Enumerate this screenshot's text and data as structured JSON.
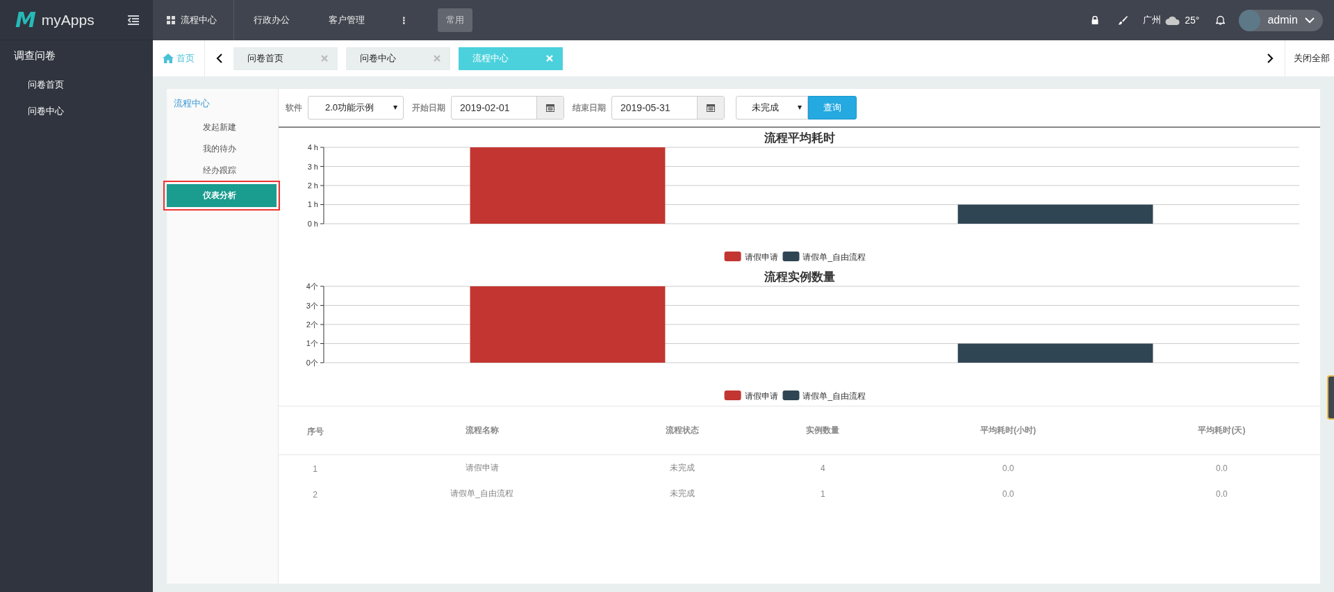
{
  "sidebar": {
    "logo_letter": "M",
    "logo_text": "myApps",
    "section": "调查问卷",
    "items": [
      {
        "label": "问卷首页",
        "selected": false
      },
      {
        "label": "问卷中心",
        "selected": false
      }
    ]
  },
  "top_nav": {
    "items": [
      {
        "label": "流程中心",
        "kind": "apps"
      },
      {
        "label": "行政办公",
        "kind": "plain"
      },
      {
        "label": "客户管理",
        "kind": "plain"
      },
      {
        "label": "⋮",
        "kind": "more"
      }
    ],
    "chip": "常用",
    "city": "广州",
    "temperature": "25°",
    "user": "admin"
  },
  "tab_bar": {
    "home": "首页",
    "tabs": [
      {
        "label": "问卷首页",
        "selected": false
      },
      {
        "label": "问卷中心",
        "selected": false
      },
      {
        "label": "流程中心",
        "selected": true
      }
    ],
    "close_all": "关闭全部"
  },
  "side_menu": {
    "title": "流程中心",
    "items": [
      {
        "label": "发起新建",
        "selected": false
      },
      {
        "label": "我的待办",
        "selected": false
      },
      {
        "label": "经办跟踪",
        "selected": false
      },
      {
        "label": "仪表分析",
        "selected": true
      }
    ]
  },
  "filters": {
    "software_label": "软件",
    "software": "2.0功能示例",
    "start_label": "开始日期",
    "start": "2019-02-01",
    "end_label": "结束日期",
    "end": "2019-05-31",
    "status": "未完成",
    "query": "查询"
  },
  "charts": [
    {
      "chart_data": {
        "type": "bar",
        "title": "流程平均耗时",
        "grid": true,
        "legend": true,
        "ylim": [
          0,
          4
        ],
        "yticks": [
          {
            "value": 0,
            "label": "0 h"
          },
          {
            "value": 1,
            "label": "1 h"
          },
          {
            "value": 2,
            "label": "2 h"
          },
          {
            "value": 3,
            "label": "3 h"
          },
          {
            "value": 4,
            "label": "4 h"
          }
        ],
        "series": [
          {
            "name": "请假申请",
            "color": "#c23531",
            "values": [
              4,
              null
            ]
          },
          {
            "name": "请假单_自由流程",
            "color": "#2f4554",
            "values": [
              null,
              1
            ]
          }
        ]
      }
    },
    {
      "chart_data": {
        "type": "bar",
        "title": "流程实例数量",
        "grid": true,
        "legend": true,
        "ylim": [
          0,
          4
        ],
        "yticks": [
          {
            "value": 0,
            "label": "0个"
          },
          {
            "value": 1,
            "label": "1个"
          },
          {
            "value": 2,
            "label": "2个"
          },
          {
            "value": 3,
            "label": "3个"
          },
          {
            "value": 4,
            "label": "4个"
          }
        ],
        "series": [
          {
            "name": "请假申请",
            "color": "#c23531",
            "values": [
              4,
              null
            ]
          },
          {
            "name": "请假单_自由流程",
            "color": "#2f4554",
            "values": [
              null,
              1
            ]
          }
        ]
      }
    }
  ],
  "table": {
    "columns": [
      "序号",
      "流程名称",
      "流程状态",
      "实例数量",
      "平均耗时(小时)",
      "平均耗时(天)"
    ],
    "rows": [
      [
        "1",
        "请假申请",
        "未完成",
        "4",
        "0.0",
        "0.0"
      ],
      [
        "2",
        "请假单_自由流程",
        "未完成",
        "1",
        "0.0",
        "0.0"
      ]
    ]
  }
}
